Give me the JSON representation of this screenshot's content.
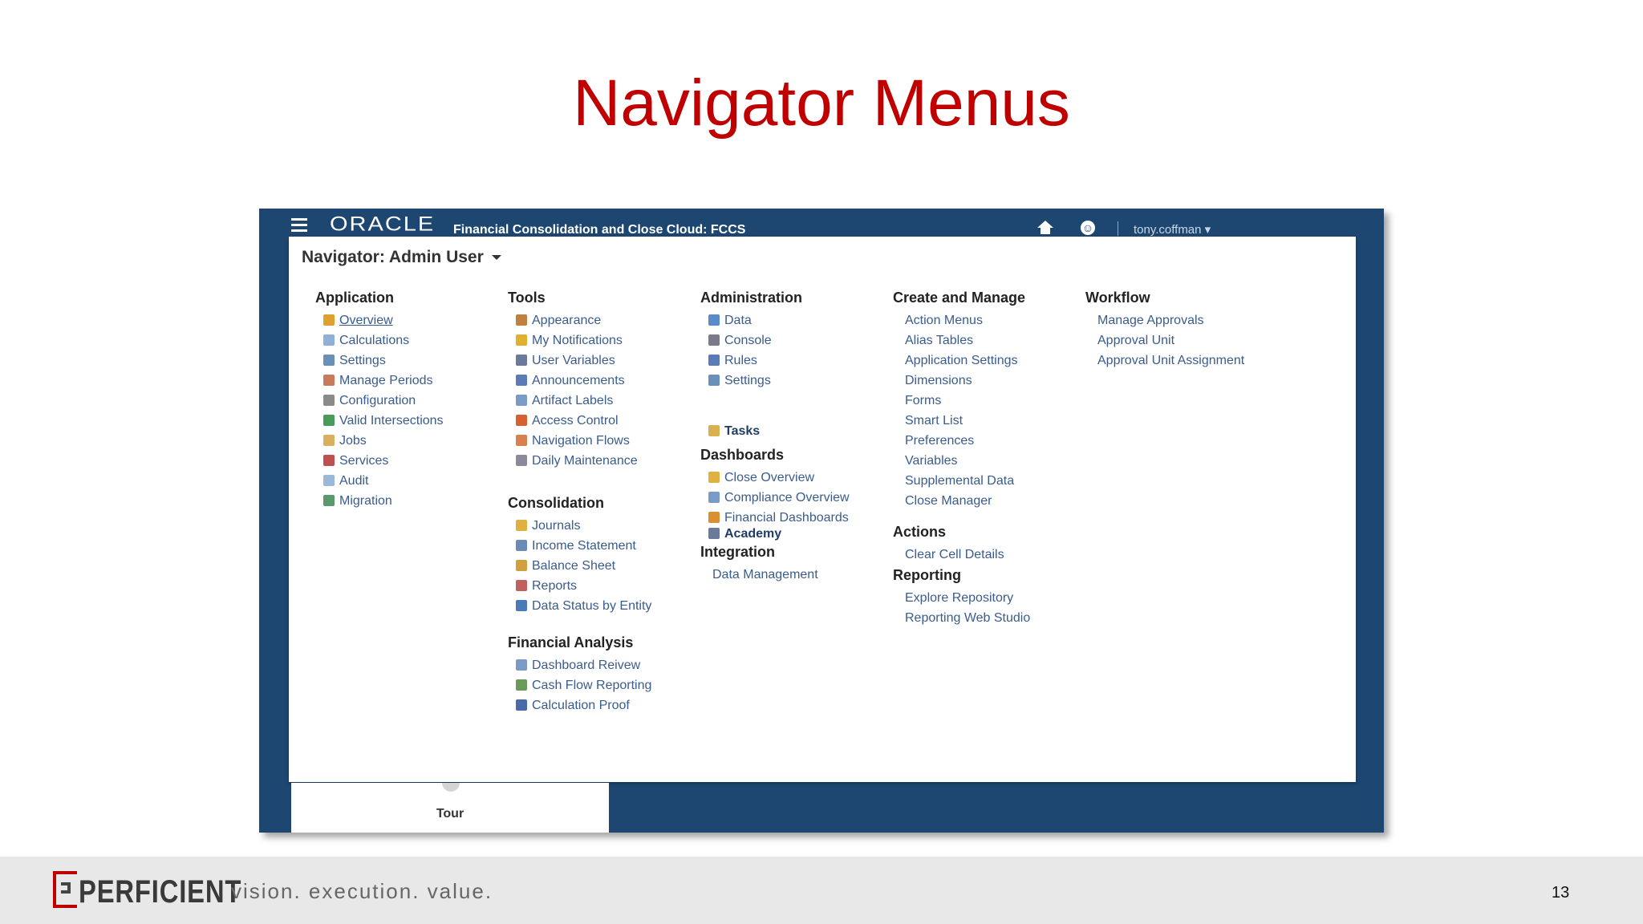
{
  "slide": {
    "title": "Navigator Menus",
    "page_number": "13"
  },
  "app": {
    "brand": "ORACLE",
    "app_name": "Financial Consolidation and Close Cloud: FCCS",
    "user": "tony.coffman"
  },
  "navigator": {
    "title": "Navigator: Admin User"
  },
  "columns": [
    {
      "sections": [
        {
          "title": "Application",
          "items": [
            {
              "label": "Overview",
              "icon": "overview-icon",
              "color": "#e0a030"
            },
            {
              "label": "Calculations",
              "icon": "calculations-icon",
              "color": "#8fb0d8"
            },
            {
              "label": "Settings",
              "icon": "settings-icon",
              "color": "#6a8fb8"
            },
            {
              "label": "Manage Periods",
              "icon": "periods-icon",
              "color": "#c97a5a"
            },
            {
              "label": "Configuration",
              "icon": "configuration-icon",
              "color": "#8a8a8a"
            },
            {
              "label": "Valid Intersections",
              "icon": "valid-intersections-icon",
              "color": "#4a9a5a"
            },
            {
              "label": "Jobs",
              "icon": "jobs-icon",
              "color": "#d8b060"
            },
            {
              "label": "Services",
              "icon": "services-icon",
              "color": "#c05050"
            },
            {
              "label": "Audit",
              "icon": "audit-icon",
              "color": "#9ab8d8"
            },
            {
              "label": "Migration",
              "icon": "migration-icon",
              "color": "#5a9a6a"
            }
          ]
        }
      ]
    },
    {
      "sections": [
        {
          "title": "Tools",
          "items": [
            {
              "label": "Appearance",
              "icon": "appearance-icon",
              "color": "#c08040"
            },
            {
              "label": "My Notifications",
              "icon": "notifications-icon",
              "color": "#e0b030"
            },
            {
              "label": "User Variables",
              "icon": "user-variables-icon",
              "color": "#6a7a9a"
            },
            {
              "label": "Announcements",
              "icon": "announcements-icon",
              "color": "#5a7ab8"
            },
            {
              "label": "Artifact Labels",
              "icon": "artifact-labels-icon",
              "color": "#7a9ac8"
            },
            {
              "label": "Access Control",
              "icon": "access-control-icon",
              "color": "#d86030"
            },
            {
              "label": "Navigation Flows",
              "icon": "navigation-flows-icon",
              "color": "#d88050"
            },
            {
              "label": "Daily Maintenance",
              "icon": "maintenance-icon",
              "color": "#8a8a9a"
            }
          ]
        },
        {
          "title": "Consolidation",
          "items": [
            {
              "label": "Journals",
              "icon": "journals-icon",
              "color": "#e0b040"
            },
            {
              "label": "Income Statement",
              "icon": "income-statement-icon",
              "color": "#6a8ab8"
            },
            {
              "label": "Balance Sheet",
              "icon": "balance-sheet-icon",
              "color": "#d0a040"
            },
            {
              "label": "Reports",
              "icon": "reports-icon",
              "color": "#c06060"
            },
            {
              "label": "Data Status by Entity",
              "icon": "data-status-icon",
              "color": "#4a7ab8"
            }
          ]
        },
        {
          "title": "Financial Analysis",
          "items": [
            {
              "label": "Dashboard Reivew",
              "icon": "dashboard-review-icon",
              "color": "#7a9ac8"
            },
            {
              "label": "Cash Flow Reporting",
              "icon": "cash-flow-icon",
              "color": "#6a9a5a"
            },
            {
              "label": "Calculation Proof",
              "icon": "calculation-proof-icon",
              "color": "#4a6aa8"
            }
          ]
        }
      ]
    },
    {
      "sections": [
        {
          "title": "Administration",
          "items": [
            {
              "label": "Data",
              "icon": "data-icon",
              "color": "#5a8ac8"
            },
            {
              "label": "Console",
              "icon": "console-icon",
              "color": "#7a7a8a"
            },
            {
              "label": "Rules",
              "icon": "rules-icon",
              "color": "#5a7ab8"
            },
            {
              "label": "Settings",
              "icon": "settings-icon",
              "color": "#6a8fb8"
            }
          ]
        },
        {
          "title": "",
          "items": [
            {
              "label": "Tasks",
              "icon": "tasks-icon",
              "color": "#d8b050",
              "bold": true
            }
          ]
        },
        {
          "title": "Dashboards",
          "items": [
            {
              "label": "Close Overview",
              "icon": "close-overview-icon",
              "color": "#e0b040"
            },
            {
              "label": "Compliance Overview",
              "icon": "compliance-icon",
              "color": "#7a9ac8"
            },
            {
              "label": "Financial Dashboards",
              "icon": "financial-dashboards-icon",
              "color": "#d89030"
            }
          ]
        },
        {
          "title": "",
          "items": [
            {
              "label": "Academy",
              "icon": "academy-icon",
              "color": "#6a7a9a",
              "bold": true
            }
          ]
        },
        {
          "title": "Integration",
          "items": [
            {
              "label": "Data Management",
              "icon": "",
              "color": ""
            }
          ]
        }
      ]
    },
    {
      "sections": [
        {
          "title": "Create and Manage",
          "items": [
            {
              "label": "Action Menus"
            },
            {
              "label": "Alias Tables"
            },
            {
              "label": "Application Settings"
            },
            {
              "label": "Dimensions"
            },
            {
              "label": "Forms"
            },
            {
              "label": "Smart List"
            },
            {
              "label": "Preferences"
            },
            {
              "label": "Variables"
            },
            {
              "label": "Supplemental Data"
            },
            {
              "label": "Close Manager"
            }
          ]
        },
        {
          "title": "Actions",
          "items": [
            {
              "label": "Clear Cell Details"
            }
          ]
        },
        {
          "title": "Reporting",
          "items": [
            {
              "label": "Explore Repository"
            },
            {
              "label": "Reporting Web Studio"
            }
          ]
        }
      ]
    },
    {
      "sections": [
        {
          "title": "Workflow",
          "items": [
            {
              "label": "Manage Approvals"
            },
            {
              "label": "Approval Unit"
            },
            {
              "label": "Approval Unit Assignment"
            }
          ]
        }
      ]
    }
  ],
  "tour": {
    "label": "Tour"
  },
  "footer": {
    "brand": "PERFICIENT",
    "tagline": "vision.  execution.  value."
  }
}
